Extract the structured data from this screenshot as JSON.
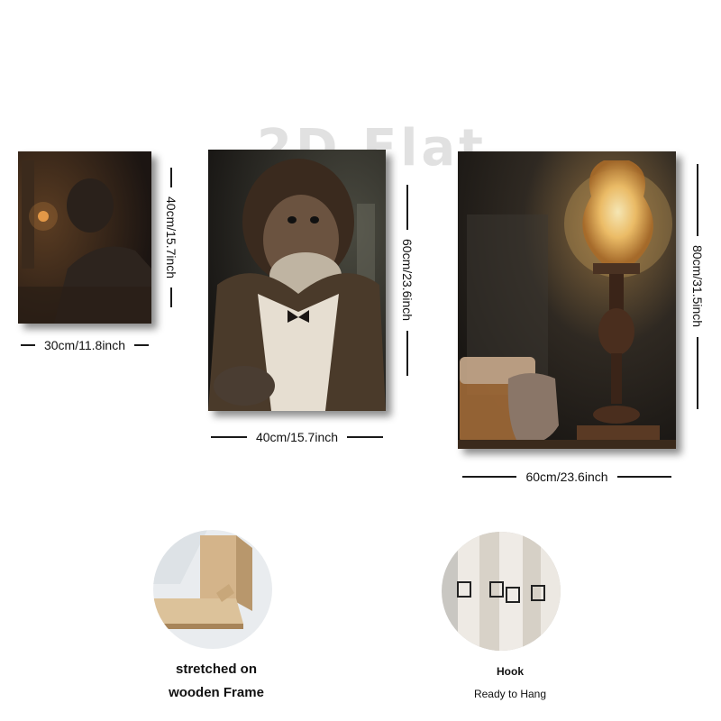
{
  "watermark": "2D Flat",
  "panels": {
    "small": {
      "width_label": "30cm/11.8inch",
      "height_label": "40cm/15.7inch"
    },
    "medium": {
      "width_label": "40cm/15.7inch",
      "height_label": "60cm/23.6inch"
    },
    "large": {
      "width_label": "60cm/23.6inch",
      "height_label": "80cm/31.5inch"
    }
  },
  "features": {
    "frame_caption_line1": "stretched on",
    "frame_caption_line2": "wooden Frame",
    "hook_caption_line1": "Hook",
    "hook_caption_line2": "Ready to Hang"
  },
  "colors": {
    "background": "#ffffff",
    "dimension_line": "#1a1a1a",
    "lamp_glow": "#f4c36a"
  }
}
